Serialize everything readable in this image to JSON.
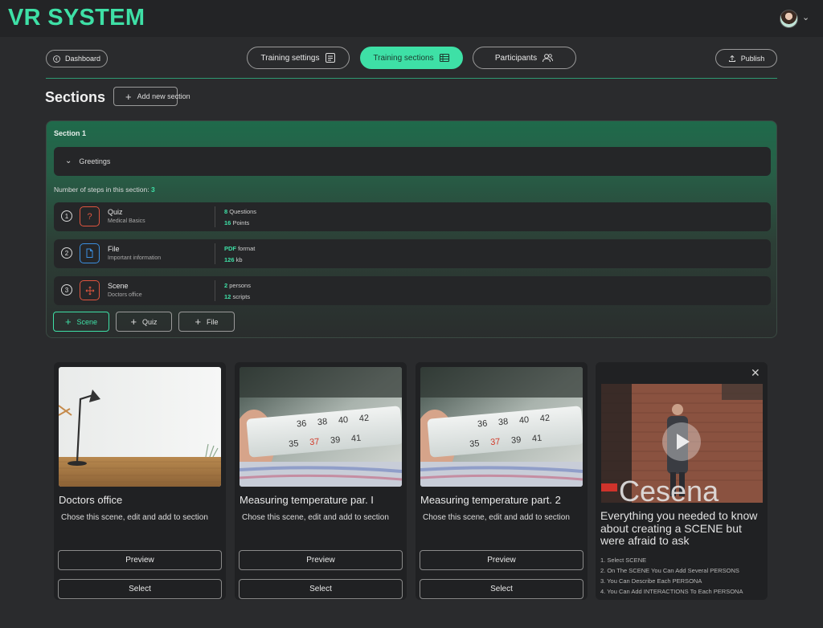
{
  "header": {
    "brand": "VR SYSTEM"
  },
  "nav": {
    "dashboard": "Dashboard",
    "tabs": [
      "Training settings",
      "Training sections",
      "Participants"
    ],
    "publish": "Publish"
  },
  "sections_heading": "Sections",
  "add_section": "Add new section",
  "section": {
    "title": "Section 1",
    "group": "Greetings",
    "steps_label": "Number of steps in this section:",
    "steps_count": "3",
    "steps": [
      {
        "num": "1",
        "title": "Quiz",
        "subtitle": "Medical Basics",
        "m1_val": "8",
        "m1_unit": "Questions",
        "m2_val": "16",
        "m2_unit": "Points",
        "icon": "question-icon",
        "color": "#e0553f"
      },
      {
        "num": "2",
        "title": "File",
        "subtitle": "Important information",
        "m1_val": "PDF",
        "m1_unit": "format",
        "m2_val": "126",
        "m2_unit": "kb",
        "icon": "file-icon",
        "color": "#3b8fe0"
      },
      {
        "num": "3",
        "title": "Scene",
        "subtitle": "Doctors office",
        "m1_val": "2",
        "m1_unit": "persons",
        "m2_val": "12",
        "m2_unit": "scripts",
        "icon": "move-icon",
        "color": "#e0553f"
      }
    ],
    "add_buttons": [
      "Scene",
      "Quiz",
      "File"
    ]
  },
  "cards": [
    {
      "title": "Doctors office",
      "desc": "Chose this scene, edit and add to section",
      "preview": "Preview",
      "select": "Select"
    },
    {
      "title": "Measuring temperature par. I",
      "desc": "Chose this scene, edit and add to section",
      "preview": "Preview",
      "select": "Select"
    },
    {
      "title": "Measuring temperature part. 2",
      "desc": "Chose this scene, edit and add to section",
      "preview": "Preview",
      "select": "Select"
    }
  ],
  "info": {
    "title": "Everything you needed to know about creating a SCENE but were afraid to ask",
    "items": [
      "1. Select SCENE",
      "2. On The SCENE You Can Add Several PERSONS",
      "3. You Can Describe Each PERSONA",
      "4. You Can Add INTERACTIONS To Each PERSONA"
    ],
    "video_text": "Cesena"
  },
  "thermo_numbers": [
    "36",
    "38",
    "40",
    "42",
    "35",
    "37",
    "39",
    "41"
  ],
  "colors": {
    "accent": "#3ee0a6",
    "background": "#2a2b2d",
    "danger": "#e0553f",
    "info": "#3b8fe0"
  }
}
